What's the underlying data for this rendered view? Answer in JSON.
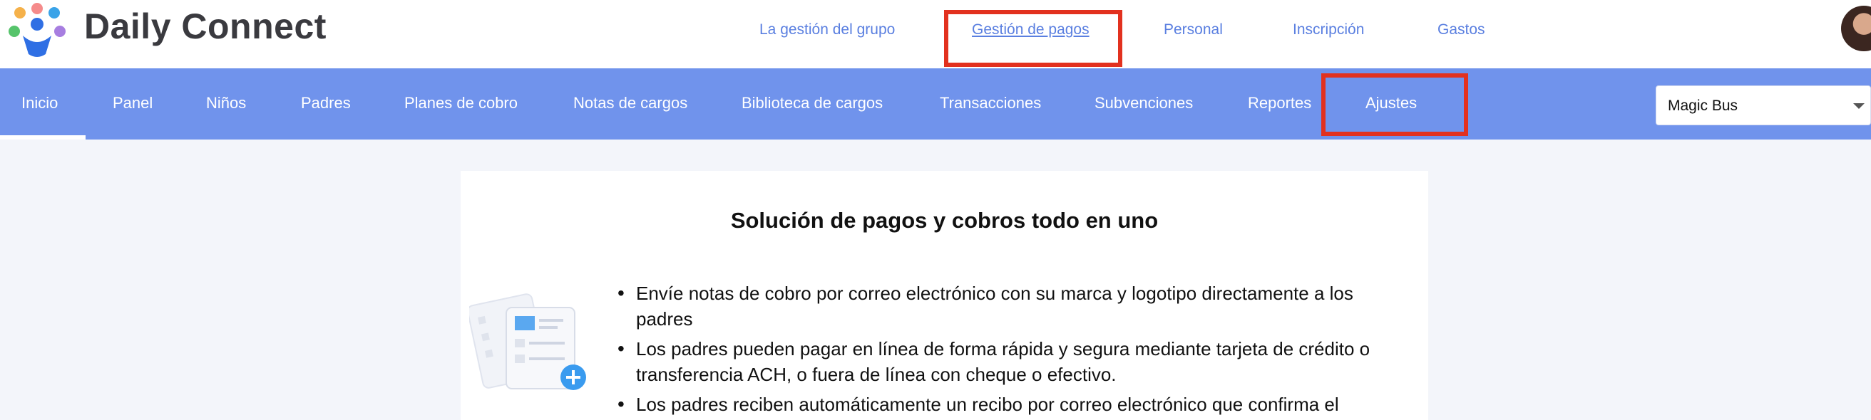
{
  "brand": {
    "name": "Daily Connect"
  },
  "top_nav": {
    "items": [
      {
        "label": "La gestión del grupo"
      },
      {
        "label": "Gestión de pagos"
      },
      {
        "label": "Personal"
      },
      {
        "label": "Inscripción"
      },
      {
        "label": "Gastos"
      }
    ],
    "active_index": 1
  },
  "main_nav": {
    "items": [
      {
        "label": "Inicio"
      },
      {
        "label": "Panel"
      },
      {
        "label": "Niños"
      },
      {
        "label": "Padres"
      },
      {
        "label": "Planes de cobro"
      },
      {
        "label": "Notas de cargos"
      },
      {
        "label": "Biblioteca de cargos"
      },
      {
        "label": "Transacciones"
      },
      {
        "label": "Subvenciones"
      },
      {
        "label": "Reportes"
      },
      {
        "label": "Ajustes"
      }
    ],
    "active_index": 0
  },
  "center_select": {
    "value": "Magic Bus"
  },
  "card": {
    "title": "Solución de pagos y cobros todo en uno",
    "bullets": [
      "Envíe notas de cobro por correo electrónico con su marca y logotipo directamente a los padres",
      "Los padres pueden pagar en línea de forma rápida y segura mediante tarjeta de crédito o transferencia ACH, o fuera de línea con cheque o efectivo.",
      "Los padres reciben automáticamente un recibo por correo electrónico que confirma el"
    ]
  },
  "colors": {
    "nav_bar": "#7093ec",
    "top_link": "#5a7fe0",
    "highlight": "#e2311f",
    "background": "#f3f5fa"
  },
  "icons": [
    "daily-connect-logo-icon",
    "document-add-illustration-icon",
    "chevron-down-icon"
  ]
}
